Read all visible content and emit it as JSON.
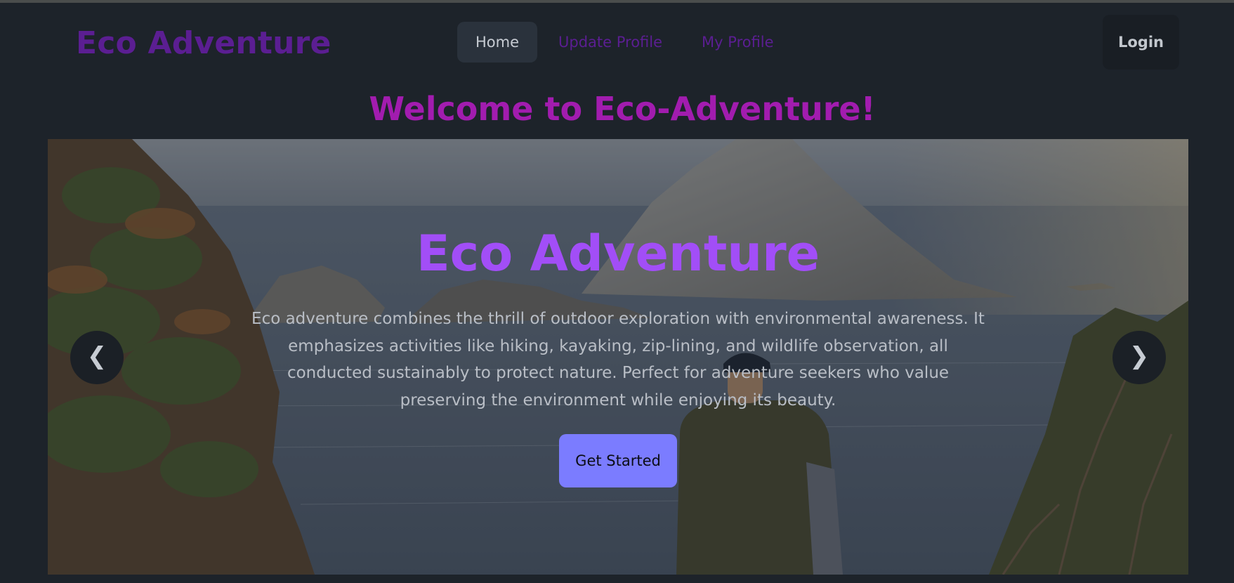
{
  "navbar": {
    "brand": "Eco Adventure",
    "menu": [
      {
        "label": "Home",
        "active": true
      },
      {
        "label": "Update Profile",
        "active": false
      },
      {
        "label": "My Profile",
        "active": false
      }
    ],
    "login_label": "Login"
  },
  "welcome": {
    "heading": "Welcome to Eco-Adventure!"
  },
  "hero": {
    "title": "Eco Adventure",
    "description": "Eco adventure combines the thrill of outdoor exploration with environmental awareness. It emphasizes activities like hiking, kayaking, zip-lining, and wildlife observation, all conducted sustainably to protect nature. Perfect for adventure seekers who value preserving the environment while enjoying its beauty.",
    "cta_label": "Get Started",
    "prev_label": "❮",
    "next_label": "❯"
  },
  "colors": {
    "background": "#1d232a",
    "brand": "#5b1e92",
    "welcome": "#a21caf",
    "hero_title": "#a24ef7",
    "cta": "#7b7cff"
  }
}
